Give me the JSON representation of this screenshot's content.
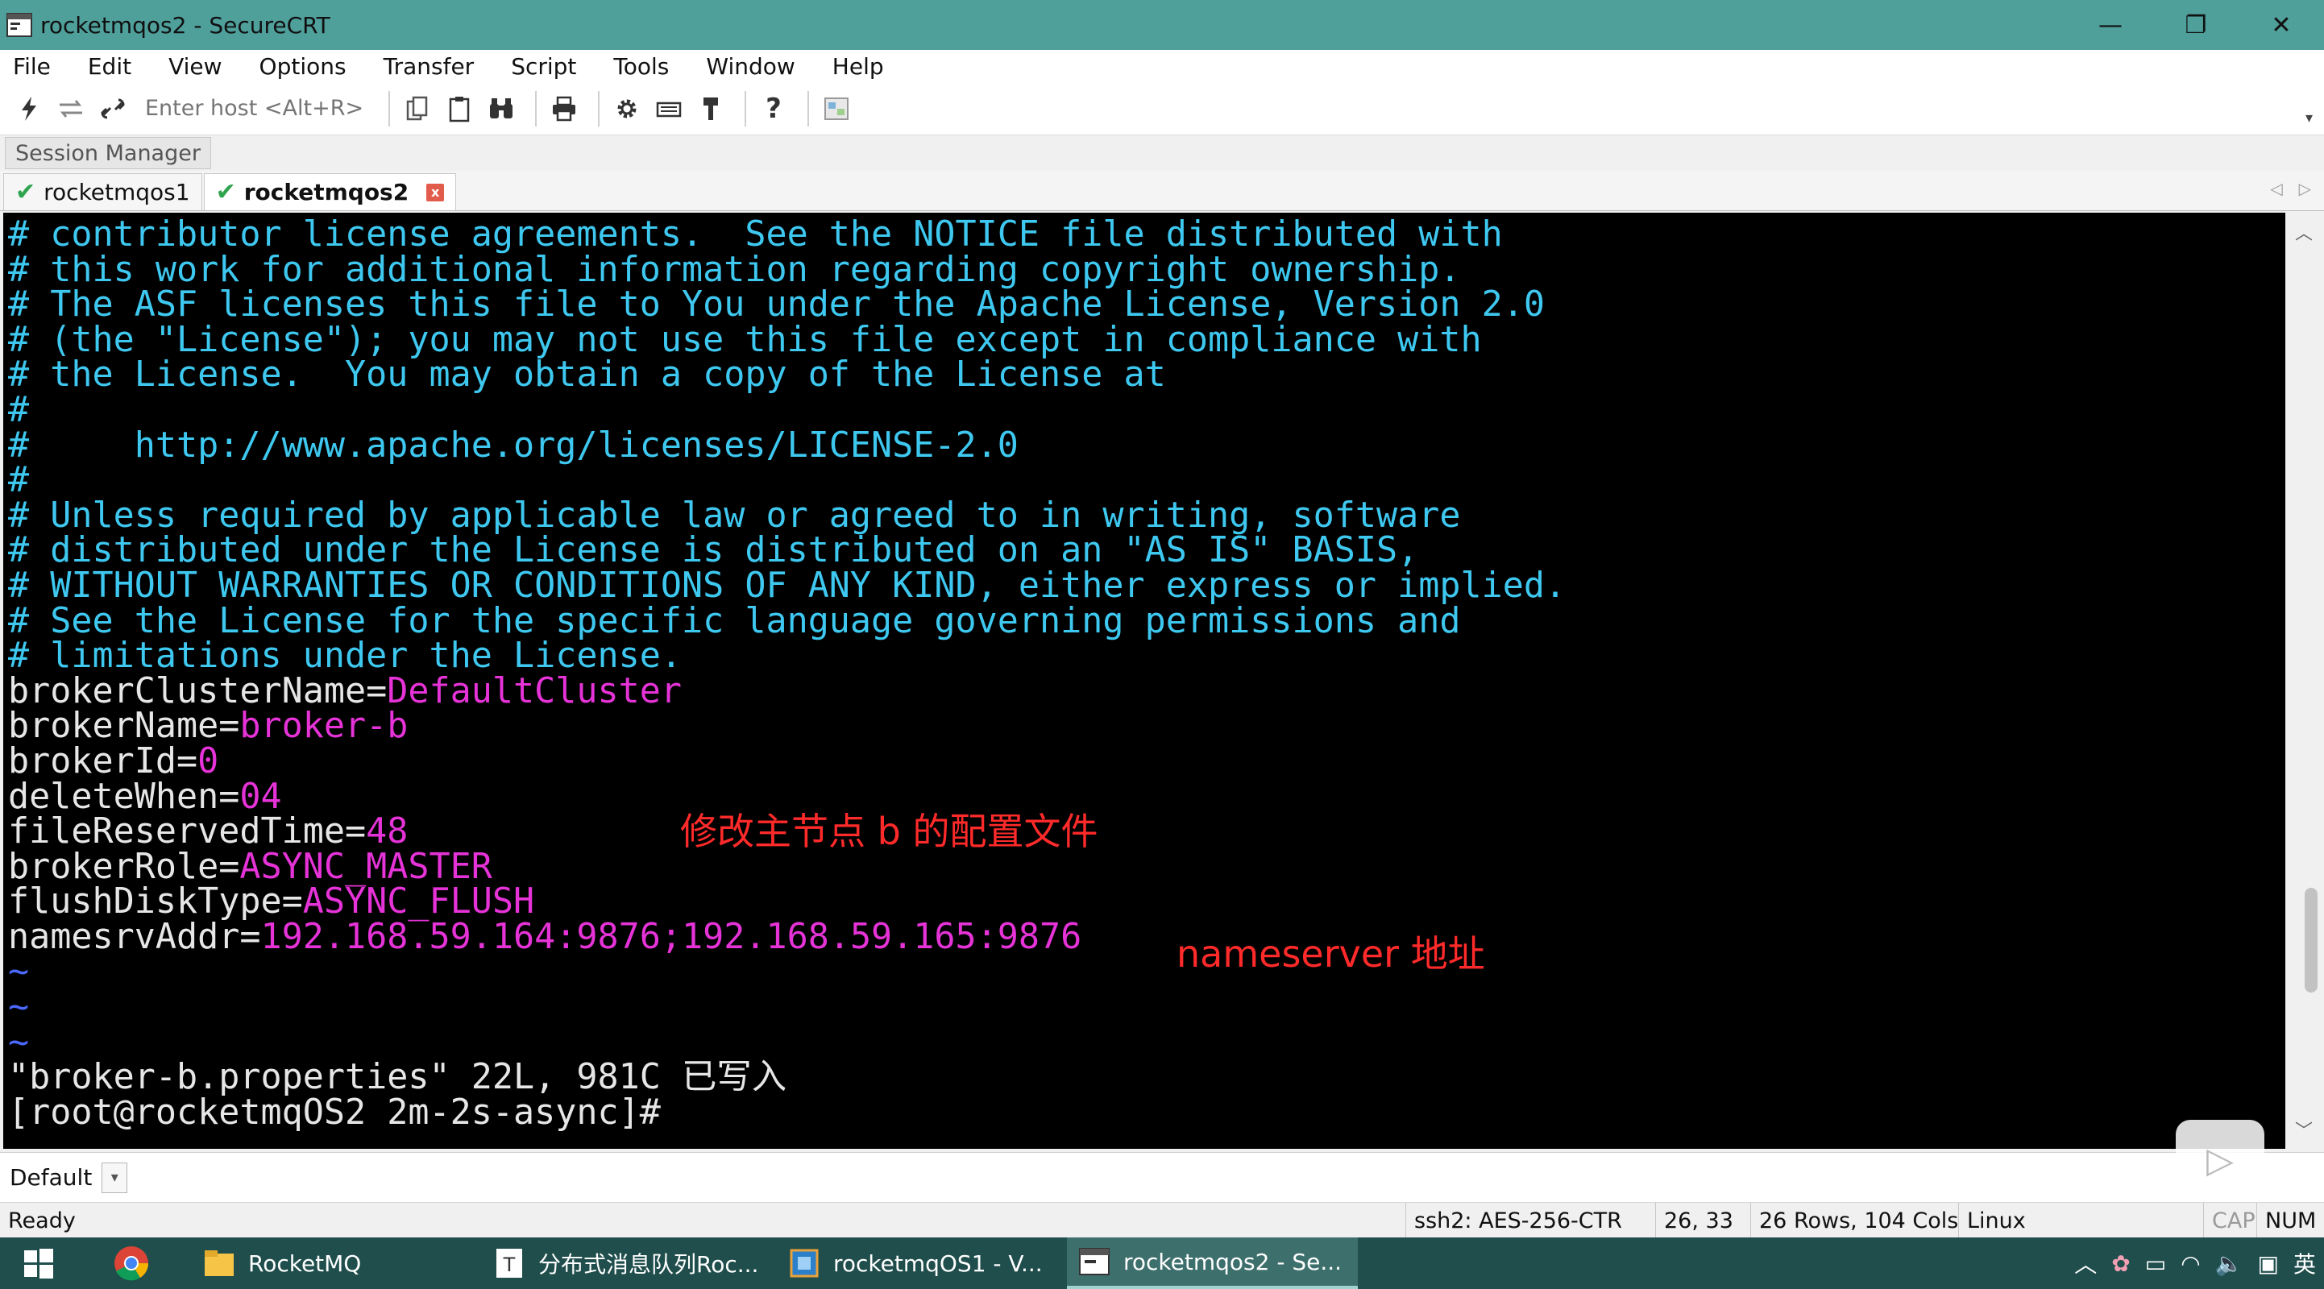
{
  "window": {
    "title": "rocketmqos2 - SecureCRT",
    "minimize": "—",
    "restore": "❐",
    "close": "✕"
  },
  "menu": [
    "File",
    "Edit",
    "View",
    "Options",
    "Transfer",
    "Script",
    "Tools",
    "Window",
    "Help"
  ],
  "toolbar": {
    "host_placeholder": "Enter host <Alt+R>",
    "icons": [
      "lightning-icon",
      "reconnect-icon",
      "link-icon",
      "copy-icon",
      "paste-icon",
      "binoculars-icon",
      "print-icon",
      "gear-icon",
      "keyboard-icon",
      "key-icon",
      "help-icon",
      "keymap-icon"
    ]
  },
  "session_manager": {
    "label": "Session Manager"
  },
  "tabs": [
    {
      "label": "rocketmqos1",
      "active": false
    },
    {
      "label": "rocketmqos2",
      "active": true
    }
  ],
  "terminal": {
    "lines": [
      {
        "text": "# contributor license agreements.  See the NOTICE file distributed with",
        "color": "cyan"
      },
      {
        "text": "# this work for additional information regarding copyright ownership.",
        "color": "cyan"
      },
      {
        "text": "# The ASF licenses this file to You under the Apache License, Version 2.0",
        "color": "cyan"
      },
      {
        "text": "# (the \"License\"); you may not use this file except in compliance with",
        "color": "cyan"
      },
      {
        "text": "# the License.  You may obtain a copy of the License at",
        "color": "cyan"
      },
      {
        "text": "#",
        "color": "cyan"
      },
      {
        "text": "#     http://www.apache.org/licenses/LICENSE-2.0",
        "color": "cyan"
      },
      {
        "text": "#",
        "color": "cyan"
      },
      {
        "text": "# Unless required by applicable law or agreed to in writing, software",
        "color": "cyan"
      },
      {
        "text": "# distributed under the License is distributed on an \"AS IS\" BASIS,",
        "color": "cyan"
      },
      {
        "text": "# WITHOUT WARRANTIES OR CONDITIONS OF ANY KIND, either express or implied.",
        "color": "cyan"
      },
      {
        "text": "# See the License for the specific language governing permissions and",
        "color": "cyan"
      },
      {
        "text": "# limitations under the License.",
        "color": "cyan"
      }
    ],
    "properties": [
      {
        "key": "brokerClusterName",
        "value": "DefaultCluster"
      },
      {
        "key": "brokerName",
        "value": "broker-b"
      },
      {
        "key": "brokerId",
        "value": "0"
      },
      {
        "key": "deleteWhen",
        "value": "04"
      },
      {
        "key": "fileReservedTime",
        "value": "48"
      },
      {
        "key": "brokerRole",
        "value": "ASYNC_MASTER"
      },
      {
        "key": "flushDiskType",
        "value": "ASYNC_FLUSH"
      },
      {
        "key": "namesrvAddr",
        "value": "192.168.59.164:9876;192.168.59.165:9876"
      }
    ],
    "tilde": [
      "~",
      "~",
      "~"
    ],
    "status_line": "\"broker-b.properties\" 22L, 981C 已写入",
    "prompt": "[root@rocketmqOS2 2m-2s-async]#"
  },
  "annotations": {
    "broker_note": "修改主节点 b 的配置文件",
    "nameserver_note": "nameserver 地址"
  },
  "command_window": {
    "selected": "Default"
  },
  "statusbar": {
    "ready": "Ready",
    "cipher": "ssh2: AES-256-CTR",
    "cursor": "26,  33",
    "size": "26 Rows, 104 Cols",
    "os": "Linux",
    "cap": "CAP",
    "num": "NUM"
  },
  "taskbar": {
    "items": [
      {
        "label": "RocketMQ",
        "icon": "folder-icon"
      },
      {
        "label": "分布式消息队列Roc...",
        "icon": "typora-icon"
      },
      {
        "label": "rocketmqOS1 - V...",
        "icon": "vm-icon"
      },
      {
        "label": "rocketmqos2 - Se...",
        "icon": "securecrt-icon",
        "active": true
      }
    ]
  },
  "colors": {
    "titlebar": "#4f9f9b",
    "comment": "#3ec8f0",
    "key": "#e6e6e6",
    "value": "#e633d8",
    "tilde": "#4b68ff",
    "annotation": "#ff2a2a"
  }
}
